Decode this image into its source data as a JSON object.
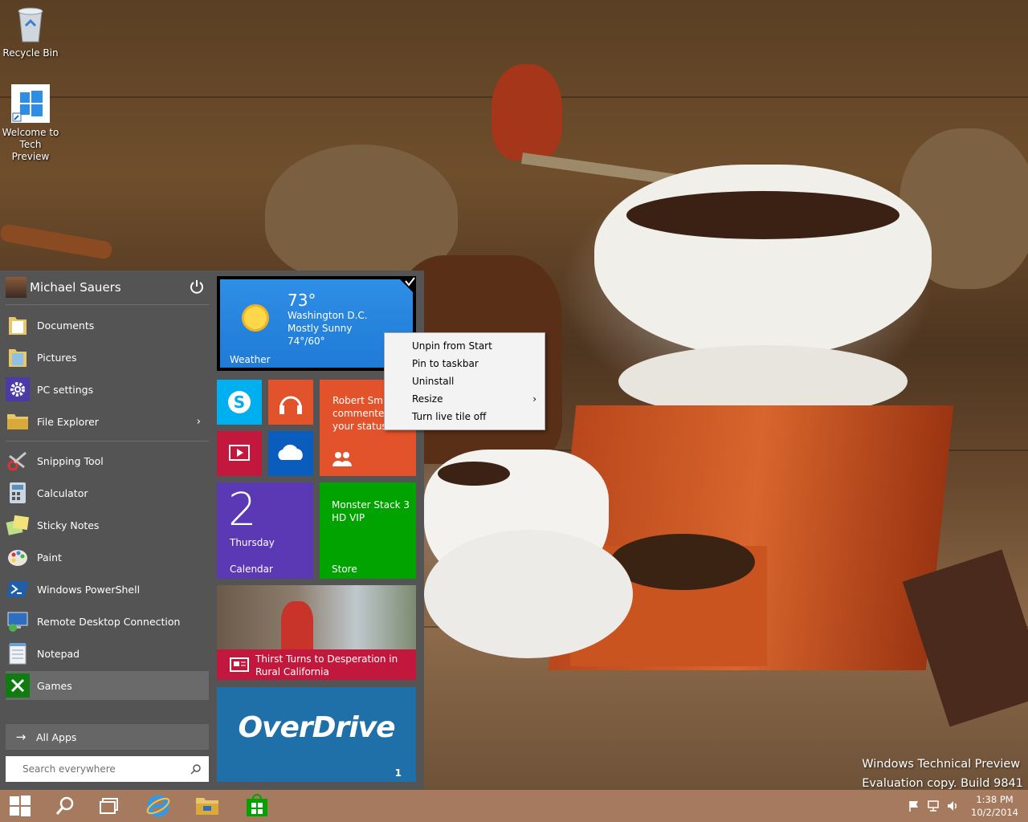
{
  "desktop": {
    "icons": [
      {
        "label": "Recycle Bin"
      },
      {
        "label": "Welcome to Tech Preview"
      }
    ],
    "watermark": {
      "line1": "Windows Technical Preview",
      "line2": "Evaluation copy. Build 9841"
    }
  },
  "start_menu": {
    "user": "Michael Sauers",
    "places": [
      {
        "label": "Documents",
        "icon": "folder-icon"
      },
      {
        "label": "Pictures",
        "icon": "folder-icon"
      },
      {
        "label": "PC settings",
        "icon": "gear-icon"
      },
      {
        "label": "File Explorer",
        "icon": "file-explorer-icon"
      }
    ],
    "apps": [
      {
        "label": "Snipping Tool",
        "icon": "scissors-icon"
      },
      {
        "label": "Calculator",
        "icon": "calculator-icon"
      },
      {
        "label": "Sticky Notes",
        "icon": "sticky-notes-icon"
      },
      {
        "label": "Paint",
        "icon": "palette-icon"
      },
      {
        "label": "Windows PowerShell",
        "icon": "powershell-icon"
      },
      {
        "label": "Remote Desktop Connection",
        "icon": "remote-desktop-icon"
      },
      {
        "label": "Notepad",
        "icon": "notepad-icon"
      },
      {
        "label": "Games",
        "icon": "xbox-icon"
      }
    ],
    "all_apps": "All Apps",
    "search_placeholder": "Search everywhere"
  },
  "tiles": {
    "weather": {
      "temp": "73°",
      "city": "Washington D.C.",
      "condition": "Mostly Sunny",
      "range": "74°/60°",
      "label": "Weather"
    },
    "people": {
      "line1": "Robert Smit",
      "line2": "commented",
      "line3": "your status."
    },
    "calendar": {
      "day": "2",
      "weekday": "Thursday",
      "label": "Calendar"
    },
    "store": {
      "line1": "Monster Stack 3",
      "line2": "HD VIP",
      "label": "Store"
    },
    "news": {
      "line1": "Thirst Turns to Desperation in",
      "line2": "Rural California"
    },
    "overdrive": {
      "brand": "OverDrive",
      "badge": "1"
    }
  },
  "context_menu": {
    "items": [
      "Unpin from Start",
      "Pin to taskbar",
      "Uninstall",
      "Resize",
      "Turn live tile off"
    ]
  },
  "taskbar": {
    "time": "1:38 PM",
    "date": "10/2/2014",
    "colors": {
      "bar": "#a57a5f",
      "tile_green": "#00a300",
      "accent": "#2e8de5"
    }
  }
}
